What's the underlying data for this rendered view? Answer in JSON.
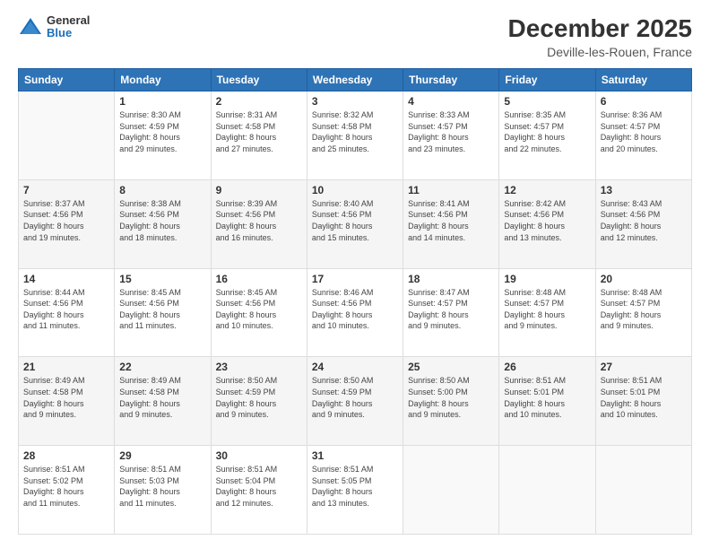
{
  "header": {
    "logo": {
      "general": "General",
      "blue": "Blue"
    },
    "title": "December 2025",
    "subtitle": "Deville-les-Rouen, France"
  },
  "calendar": {
    "days_of_week": [
      "Sunday",
      "Monday",
      "Tuesday",
      "Wednesday",
      "Thursday",
      "Friday",
      "Saturday"
    ],
    "weeks": [
      [
        {
          "day": "",
          "info": ""
        },
        {
          "day": "1",
          "info": "Sunrise: 8:30 AM\nSunset: 4:59 PM\nDaylight: 8 hours\nand 29 minutes."
        },
        {
          "day": "2",
          "info": "Sunrise: 8:31 AM\nSunset: 4:58 PM\nDaylight: 8 hours\nand 27 minutes."
        },
        {
          "day": "3",
          "info": "Sunrise: 8:32 AM\nSunset: 4:58 PM\nDaylight: 8 hours\nand 25 minutes."
        },
        {
          "day": "4",
          "info": "Sunrise: 8:33 AM\nSunset: 4:57 PM\nDaylight: 8 hours\nand 23 minutes."
        },
        {
          "day": "5",
          "info": "Sunrise: 8:35 AM\nSunset: 4:57 PM\nDaylight: 8 hours\nand 22 minutes."
        },
        {
          "day": "6",
          "info": "Sunrise: 8:36 AM\nSunset: 4:57 PM\nDaylight: 8 hours\nand 20 minutes."
        }
      ],
      [
        {
          "day": "7",
          "info": "Sunrise: 8:37 AM\nSunset: 4:56 PM\nDaylight: 8 hours\nand 19 minutes."
        },
        {
          "day": "8",
          "info": "Sunrise: 8:38 AM\nSunset: 4:56 PM\nDaylight: 8 hours\nand 18 minutes."
        },
        {
          "day": "9",
          "info": "Sunrise: 8:39 AM\nSunset: 4:56 PM\nDaylight: 8 hours\nand 16 minutes."
        },
        {
          "day": "10",
          "info": "Sunrise: 8:40 AM\nSunset: 4:56 PM\nDaylight: 8 hours\nand 15 minutes."
        },
        {
          "day": "11",
          "info": "Sunrise: 8:41 AM\nSunset: 4:56 PM\nDaylight: 8 hours\nand 14 minutes."
        },
        {
          "day": "12",
          "info": "Sunrise: 8:42 AM\nSunset: 4:56 PM\nDaylight: 8 hours\nand 13 minutes."
        },
        {
          "day": "13",
          "info": "Sunrise: 8:43 AM\nSunset: 4:56 PM\nDaylight: 8 hours\nand 12 minutes."
        }
      ],
      [
        {
          "day": "14",
          "info": "Sunrise: 8:44 AM\nSunset: 4:56 PM\nDaylight: 8 hours\nand 11 minutes."
        },
        {
          "day": "15",
          "info": "Sunrise: 8:45 AM\nSunset: 4:56 PM\nDaylight: 8 hours\nand 11 minutes."
        },
        {
          "day": "16",
          "info": "Sunrise: 8:45 AM\nSunset: 4:56 PM\nDaylight: 8 hours\nand 10 minutes."
        },
        {
          "day": "17",
          "info": "Sunrise: 8:46 AM\nSunset: 4:56 PM\nDaylight: 8 hours\nand 10 minutes."
        },
        {
          "day": "18",
          "info": "Sunrise: 8:47 AM\nSunset: 4:57 PM\nDaylight: 8 hours\nand 9 minutes."
        },
        {
          "day": "19",
          "info": "Sunrise: 8:48 AM\nSunset: 4:57 PM\nDaylight: 8 hours\nand 9 minutes."
        },
        {
          "day": "20",
          "info": "Sunrise: 8:48 AM\nSunset: 4:57 PM\nDaylight: 8 hours\nand 9 minutes."
        }
      ],
      [
        {
          "day": "21",
          "info": "Sunrise: 8:49 AM\nSunset: 4:58 PM\nDaylight: 8 hours\nand 9 minutes."
        },
        {
          "day": "22",
          "info": "Sunrise: 8:49 AM\nSunset: 4:58 PM\nDaylight: 8 hours\nand 9 minutes."
        },
        {
          "day": "23",
          "info": "Sunrise: 8:50 AM\nSunset: 4:59 PM\nDaylight: 8 hours\nand 9 minutes."
        },
        {
          "day": "24",
          "info": "Sunrise: 8:50 AM\nSunset: 4:59 PM\nDaylight: 8 hours\nand 9 minutes."
        },
        {
          "day": "25",
          "info": "Sunrise: 8:50 AM\nSunset: 5:00 PM\nDaylight: 8 hours\nand 9 minutes."
        },
        {
          "day": "26",
          "info": "Sunrise: 8:51 AM\nSunset: 5:01 PM\nDaylight: 8 hours\nand 10 minutes."
        },
        {
          "day": "27",
          "info": "Sunrise: 8:51 AM\nSunset: 5:01 PM\nDaylight: 8 hours\nand 10 minutes."
        }
      ],
      [
        {
          "day": "28",
          "info": "Sunrise: 8:51 AM\nSunset: 5:02 PM\nDaylight: 8 hours\nand 11 minutes."
        },
        {
          "day": "29",
          "info": "Sunrise: 8:51 AM\nSunset: 5:03 PM\nDaylight: 8 hours\nand 11 minutes."
        },
        {
          "day": "30",
          "info": "Sunrise: 8:51 AM\nSunset: 5:04 PM\nDaylight: 8 hours\nand 12 minutes."
        },
        {
          "day": "31",
          "info": "Sunrise: 8:51 AM\nSunset: 5:05 PM\nDaylight: 8 hours\nand 13 minutes."
        },
        {
          "day": "",
          "info": ""
        },
        {
          "day": "",
          "info": ""
        },
        {
          "day": "",
          "info": ""
        }
      ]
    ]
  }
}
